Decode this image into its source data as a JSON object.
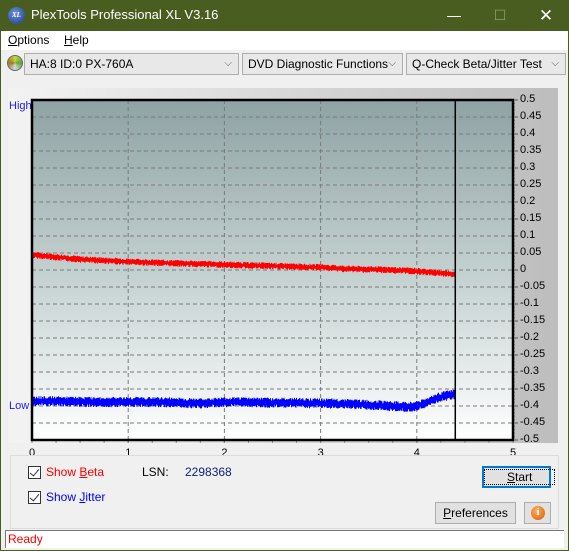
{
  "window": {
    "title": "PlexTools Professional XL V3.16",
    "app_icon": "xl-logo-icon",
    "minimize": "—",
    "maximize": "☐",
    "close": "✕"
  },
  "menu": {
    "items": [
      {
        "label": "Options",
        "accel": "O",
        "rest": "ptions"
      },
      {
        "label": "Help",
        "accel": "H",
        "rest": "elp"
      }
    ]
  },
  "toolbar": {
    "drive_icon": "disc-drive-icon",
    "drive_select": "HA:8 ID:0  PX-760A",
    "function_select": "DVD Diagnostic Functions",
    "test_select": "Q-Check Beta/Jitter Test",
    "chevron": "⌵"
  },
  "chart_data": {
    "type": "line",
    "title": "",
    "xlabel": "",
    "ylabel": "",
    "xlim": [
      0,
      5
    ],
    "ylim": [
      -0.5,
      0.5
    ],
    "x_ticks": [
      "0",
      "1",
      "2",
      "3",
      "4",
      "5"
    ],
    "y_ticks": [
      "0.5",
      "0.45",
      "0.4",
      "0.35",
      "0.3",
      "0.25",
      "0.2",
      "0.15",
      "0.1",
      "0.05",
      "0",
      "-0.05",
      "-0.1",
      "-0.15",
      "-0.2",
      "-0.25",
      "-0.3",
      "-0.35",
      "-0.4",
      "-0.45",
      "-0.5"
    ],
    "left_axis_labels": {
      "high": "High",
      "low": "Low"
    },
    "grid": true,
    "marker_x": 4.4,
    "series": [
      {
        "name": "Beta",
        "color": "#ff0000",
        "x": [
          0,
          0.25,
          0.5,
          0.75,
          1.0,
          1.25,
          1.5,
          1.75,
          2.0,
          2.25,
          2.5,
          2.75,
          3.0,
          3.25,
          3.5,
          3.75,
          4.0,
          4.2,
          4.4
        ],
        "y": [
          0.045,
          0.038,
          0.032,
          0.028,
          0.025,
          0.022,
          0.02,
          0.018,
          0.016,
          0.014,
          0.012,
          0.01,
          0.008,
          0.004,
          0.002,
          0.0,
          -0.003,
          -0.008,
          -0.012
        ],
        "noise": 0.008
      },
      {
        "name": "Jitter",
        "color": "#0000ff",
        "x": [
          0,
          0.25,
          0.5,
          0.75,
          1.0,
          1.25,
          1.5,
          1.75,
          2.0,
          2.25,
          2.5,
          2.75,
          3.0,
          3.25,
          3.5,
          3.75,
          3.95,
          4.1,
          4.25,
          4.4
        ],
        "y": [
          -0.385,
          -0.386,
          -0.387,
          -0.388,
          -0.387,
          -0.388,
          -0.389,
          -0.392,
          -0.388,
          -0.388,
          -0.39,
          -0.39,
          -0.392,
          -0.393,
          -0.396,
          -0.4,
          -0.402,
          -0.39,
          -0.372,
          -0.365
        ],
        "noise": 0.012
      }
    ]
  },
  "controls": {
    "show_beta": {
      "label_pre": "Show ",
      "accel": "B",
      "label_post": "eta",
      "checked": true,
      "color": "#ff0000"
    },
    "show_jitter": {
      "label_pre": "Show ",
      "accel": "J",
      "label_post": "itter",
      "checked": true,
      "color": "#0000ff"
    },
    "lsn_label": "LSN:",
    "lsn_value": "2298368",
    "start_button": {
      "accel": "S",
      "rest": "tart"
    },
    "preferences_button": {
      "accel": "P",
      "rest": "references"
    },
    "info_button": "i"
  },
  "status": {
    "text": "Ready"
  }
}
